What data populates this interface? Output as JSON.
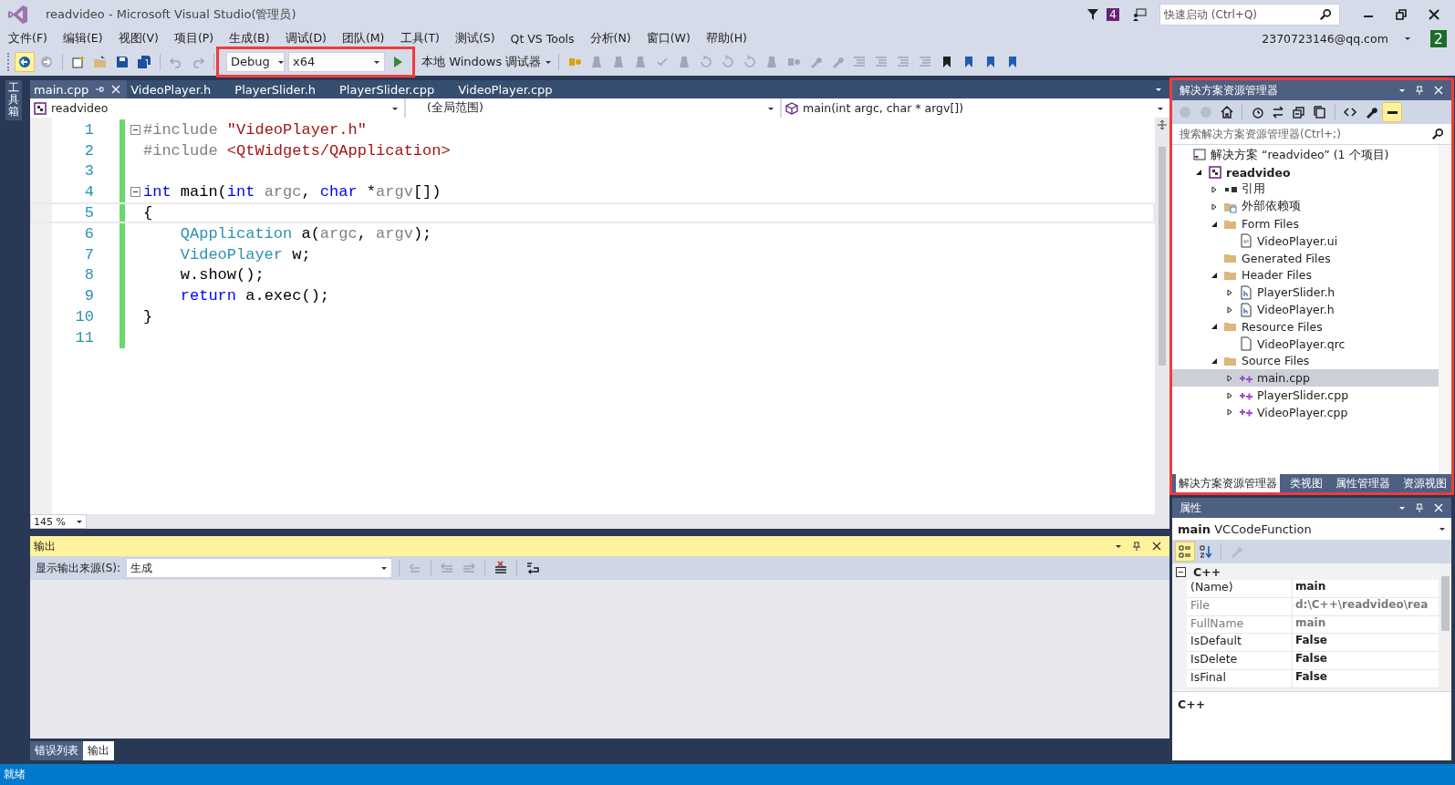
{
  "window": {
    "title": "readvideo - Microsoft Visual Studio(管理员)"
  },
  "title_bar": {
    "notification_count": "4",
    "quick_launch": {
      "placeholder": "快速启动 (Ctrl+Q)"
    }
  },
  "menu": [
    "文件(F)",
    "编辑(E)",
    "视图(V)",
    "项目(P)",
    "生成(B)",
    "调试(D)",
    "团队(M)",
    "工具(T)",
    "测试(S)",
    "Qt VS Tools",
    "分析(N)",
    "窗口(W)",
    "帮助(H)"
  ],
  "account": {
    "name": "2370723146@qq.com",
    "badge": "2"
  },
  "toolbar": {
    "configuration": "Debug",
    "platform": "x64",
    "debugger": "本地 Windows 调试器"
  },
  "toolbox_label": "工具箱",
  "editor": {
    "tabs": [
      {
        "label": "main.cpp",
        "selected": true
      },
      {
        "label": "VideoPlayer.h",
        "selected": false
      },
      {
        "label": "PlayerSlider.h",
        "selected": false
      },
      {
        "label": "PlayerSlider.cpp",
        "selected": false
      },
      {
        "label": "VideoPlayer.cpp",
        "selected": false
      }
    ],
    "project": "readvideo",
    "scope": "(全局范围)",
    "member": "main(int argc, char * argv[])",
    "lines": [
      {
        "number": "1",
        "fold": true,
        "current": false,
        "tokens": [
          {
            "kind": "directive",
            "text": "#include "
          },
          {
            "kind": "string",
            "text": "\"VideoPlayer.h\""
          }
        ]
      },
      {
        "number": "2",
        "fold": false,
        "current": false,
        "tokens": [
          {
            "kind": "directive",
            "text": "#include "
          },
          {
            "kind": "string",
            "text": "<QtWidgets/QApplication>"
          }
        ]
      },
      {
        "number": "3",
        "fold": false,
        "current": false
      },
      {
        "number": "4",
        "fold": true,
        "current": false,
        "tokens": [
          {
            "kind": "keyword",
            "text": "int"
          },
          {
            "kind": "plain",
            "text": " main("
          },
          {
            "kind": "keyword",
            "text": "int"
          },
          {
            "kind": "param",
            "text": " argc"
          },
          {
            "kind": "plain",
            "text": ", "
          },
          {
            "kind": "keyword",
            "text": "char"
          },
          {
            "kind": "plain",
            "text": " *"
          },
          {
            "kind": "param",
            "text": "argv"
          },
          {
            "kind": "plain",
            "text": "[])"
          }
        ]
      },
      {
        "number": "5",
        "fold": false,
        "current": true,
        "tokens": [
          {
            "kind": "plain",
            "text": "{"
          }
        ]
      },
      {
        "number": "6",
        "fold": false,
        "current": false,
        "tokens": [
          {
            "kind": "type",
            "text": "    QApplication"
          },
          {
            "kind": "plain",
            "text": " a("
          },
          {
            "kind": "param",
            "text": "argc"
          },
          {
            "kind": "plain",
            "text": ", "
          },
          {
            "kind": "param",
            "text": "argv"
          },
          {
            "kind": "plain",
            "text": ");"
          }
        ]
      },
      {
        "number": "7",
        "fold": false,
        "current": false,
        "tokens": [
          {
            "kind": "type",
            "text": "    VideoPlayer"
          },
          {
            "kind": "plain",
            "text": " w;"
          }
        ]
      },
      {
        "number": "8",
        "fold": false,
        "current": false,
        "tokens": [
          {
            "kind": "plain",
            "text": "    w.show();"
          }
        ]
      },
      {
        "number": "9",
        "fold": false,
        "current": false,
        "tokens": [
          {
            "kind": "keyword",
            "text": "    return"
          },
          {
            "kind": "plain",
            "text": " a.exec();"
          }
        ]
      },
      {
        "number": "10",
        "fold": false,
        "current": false,
        "tokens": [
          {
            "kind": "plain",
            "text": "}"
          }
        ]
      },
      {
        "number": "11",
        "fold": false,
        "current": false
      }
    ],
    "zoom": "145 %"
  },
  "output": {
    "title": "输出",
    "source_label": "显示输出来源(S):",
    "source": "生成"
  },
  "bottom_tabs": [
    {
      "label": "错误列表",
      "selected": false
    },
    {
      "label": "输出",
      "selected": true
    }
  ],
  "solution_explorer": {
    "title": "解决方案资源管理器",
    "search": {
      "placeholder": "搜索解决方案资源管理器(Ctrl+;)"
    },
    "tree": [
      {
        "label": "解决方案 “readvideo” (1 个项目)",
        "kind": "solution",
        "selected": false,
        "children": [
          {
            "label": "readvideo",
            "kind": "project",
            "expanded": true,
            "selected": false,
            "children": [
              {
                "label": "引用",
                "kind": "references",
                "expanded": false,
                "selected": false
              },
              {
                "label": "外部依赖项",
                "kind": "external",
                "expanded": false,
                "selected": false
              },
              {
                "label": "Form Files",
                "kind": "folder",
                "expanded": true,
                "selected": false,
                "children": [
                  {
                    "label": "VideoPlayer.ui",
                    "kind": "ui",
                    "selected": false
                  }
                ]
              },
              {
                "label": "Generated Files",
                "kind": "folder",
                "selected": false
              },
              {
                "label": "Header Files",
                "kind": "folder",
                "expanded": true,
                "selected": false,
                "children": [
                  {
                    "label": "PlayerSlider.h",
                    "kind": "header",
                    "expanded": false,
                    "selected": false
                  },
                  {
                    "label": "VideoPlayer.h",
                    "kind": "header",
                    "expanded": false,
                    "selected": false
                  }
                ]
              },
              {
                "label": "Resource Files",
                "kind": "folder",
                "expanded": true,
                "selected": false,
                "children": [
                  {
                    "label": "VideoPlayer.qrc",
                    "kind": "file",
                    "selected": false
                  }
                ]
              },
              {
                "label": "Source Files",
                "kind": "folder",
                "expanded": true,
                "selected": false,
                "children": [
                  {
                    "label": "main.cpp",
                    "kind": "cpp",
                    "expanded": false,
                    "selected": true
                  },
                  {
                    "label": "PlayerSlider.cpp",
                    "kind": "cpp",
                    "expanded": false,
                    "selected": false
                  },
                  {
                    "label": "VideoPlayer.cpp",
                    "kind": "cpp",
                    "expanded": false,
                    "selected": false
                  }
                ]
              }
            ]
          }
        ]
      }
    ],
    "tabs": [
      {
        "label": "解决方案资源管理器",
        "selected": true
      },
      {
        "label": "类视图",
        "selected": false
      },
      {
        "label": "属性管理器",
        "selected": false
      },
      {
        "label": "资源视图",
        "selected": false
      }
    ]
  },
  "properties": {
    "title": "属性",
    "object": "main",
    "object_type": "VCCodeFunction",
    "category": "C++",
    "rows": [
      {
        "name": "(Name)",
        "value": "main",
        "readonly": false
      },
      {
        "name": "File",
        "value": "d:\\C++\\readvideo\\rea",
        "readonly": true
      },
      {
        "name": "FullName",
        "value": "main",
        "readonly": true
      },
      {
        "name": "IsDefault",
        "value": "False",
        "readonly": false
      },
      {
        "name": "IsDelete",
        "value": "False",
        "readonly": false
      },
      {
        "name": "IsFinal",
        "value": "False",
        "readonly": false
      }
    ],
    "description": "C++"
  },
  "status_bar": {
    "text": "就绪"
  }
}
